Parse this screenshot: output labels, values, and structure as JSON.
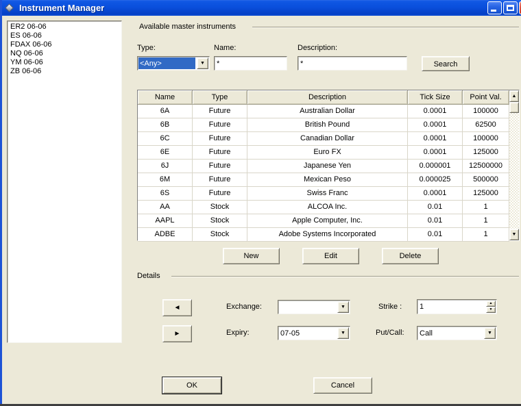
{
  "window": {
    "title": "Instrument Manager"
  },
  "sidebar": {
    "items": [
      "ER2 06-06",
      "ES 06-06",
      "FDAX 06-06",
      "NQ 06-06",
      "YM 06-06",
      "ZB 06-06"
    ]
  },
  "filters": {
    "group_label": "Available master instruments",
    "type_label": "Type:",
    "type_value": "<Any>",
    "name_label": "Name:",
    "name_value": "*",
    "description_label": "Description:",
    "description_value": "*",
    "search_label": "Search"
  },
  "table": {
    "columns": [
      "Name",
      "Type",
      "Description",
      "Tick Size",
      "Point Val."
    ],
    "rows": [
      [
        "6A",
        "Future",
        "Australian Dollar",
        "0.0001",
        "100000"
      ],
      [
        "6B",
        "Future",
        "British Pound",
        "0.0001",
        "62500"
      ],
      [
        "6C",
        "Future",
        "Canadian Dollar",
        "0.0001",
        "100000"
      ],
      [
        "6E",
        "Future",
        "Euro FX",
        "0.0001",
        "125000"
      ],
      [
        "6J",
        "Future",
        "Japanese Yen",
        "0.000001",
        "12500000"
      ],
      [
        "6M",
        "Future",
        "Mexican Peso",
        "0.000025",
        "500000"
      ],
      [
        "6S",
        "Future",
        "Swiss Franc",
        "0.0001",
        "125000"
      ],
      [
        "AA",
        "Stock",
        "ALCOA Inc.",
        "0.01",
        "1"
      ],
      [
        "AAPL",
        "Stock",
        "Apple Computer, Inc.",
        "0.01",
        "1"
      ],
      [
        "ADBE",
        "Stock",
        "Adobe Systems Incorporated",
        "0.01",
        "1"
      ]
    ]
  },
  "actions": {
    "new_label": "New",
    "edit_label": "Edit",
    "delete_label": "Delete"
  },
  "details": {
    "group_label": "Details",
    "exchange_label": "Exchange:",
    "exchange_value": "",
    "expiry_label": "Expiry:",
    "expiry_value": "07-05",
    "strike_label": "Strike :",
    "strike_value": "1",
    "putcall_label": "Put/Call:",
    "putcall_value": "Call"
  },
  "footer": {
    "ok_label": "OK",
    "cancel_label": "Cancel"
  },
  "icons": {
    "dropdown_arrow": "▼",
    "spin_up": "▲",
    "spin_down": "▼",
    "scroll_up": "▲",
    "scroll_down": "▼",
    "nav_left": "◄",
    "nav_right": "►"
  },
  "colors": {
    "titlebar_blue": "#0A4FDC",
    "selection_blue": "#316AC5",
    "dialog_face": "#ECE9D8",
    "close_red": "#E35948"
  }
}
